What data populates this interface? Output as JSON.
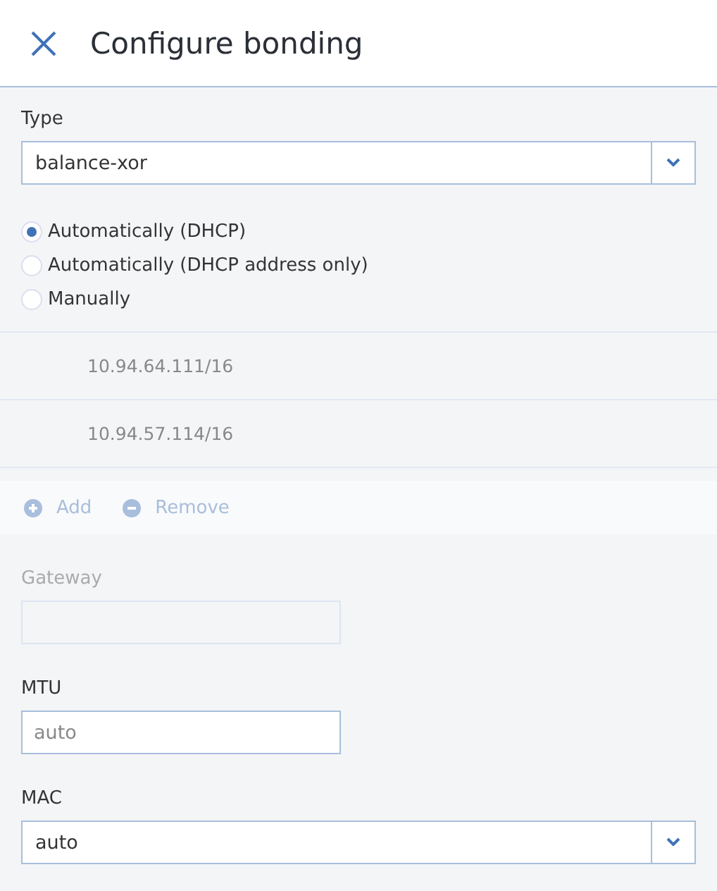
{
  "header": {
    "title": "Configure bonding"
  },
  "type_field": {
    "label": "Type",
    "value": "balance-xor"
  },
  "ip_modes": [
    {
      "label": "Automatically (DHCP)",
      "selected": true
    },
    {
      "label": "Automatically (DHCP address only)",
      "selected": false
    },
    {
      "label": "Manually",
      "selected": false
    }
  ],
  "addresses": [
    "10.94.64.111/16",
    "10.94.57.114/16"
  ],
  "address_actions": [
    {
      "kind": "add",
      "label": "Add",
      "disabled": true
    },
    {
      "kind": "remove",
      "label": "Remove",
      "disabled": true
    }
  ],
  "gateway": {
    "label": "Gateway",
    "disabled": true
  },
  "mtu": {
    "label": "MTU",
    "placeholder": "auto"
  },
  "mac": {
    "label": "MAC",
    "value": "auto"
  }
}
